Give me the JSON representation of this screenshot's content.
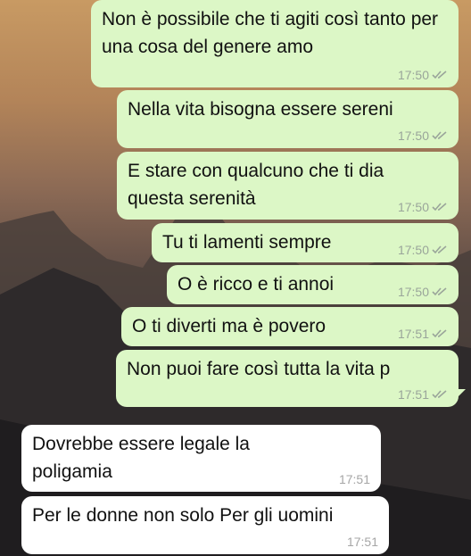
{
  "messages": [
    {
      "text": "Non è possibile che ti agiti così tanto per una cosa del genere amo",
      "time": "17:50"
    },
    {
      "text": "Nella vita bisogna essere sereni",
      "time": "17:50"
    },
    {
      "text": "E stare con qualcuno che ti dia questa serenità",
      "time": "17:50"
    },
    {
      "text": "Tu ti lamenti sempre",
      "time": "17:50"
    },
    {
      "text": "O è ricco e ti annoi",
      "time": "17:50"
    },
    {
      "text": "O ti diverti ma è povero",
      "time": "17:51"
    },
    {
      "text": "Non puoi fare così tutta la vita p",
      "time": "17:51"
    },
    {
      "text": "Dovrebbe essere legale la poligamia",
      "time": "17:51"
    },
    {
      "text": "Per le donne non solo Per gli uomini",
      "time": "17:51"
    }
  ],
  "colors": {
    "outgoing": "#dcf7c6",
    "incoming": "#ffffff",
    "ticks": "#9aa59a"
  },
  "icons": {
    "read_receipt": "double-check-icon"
  }
}
